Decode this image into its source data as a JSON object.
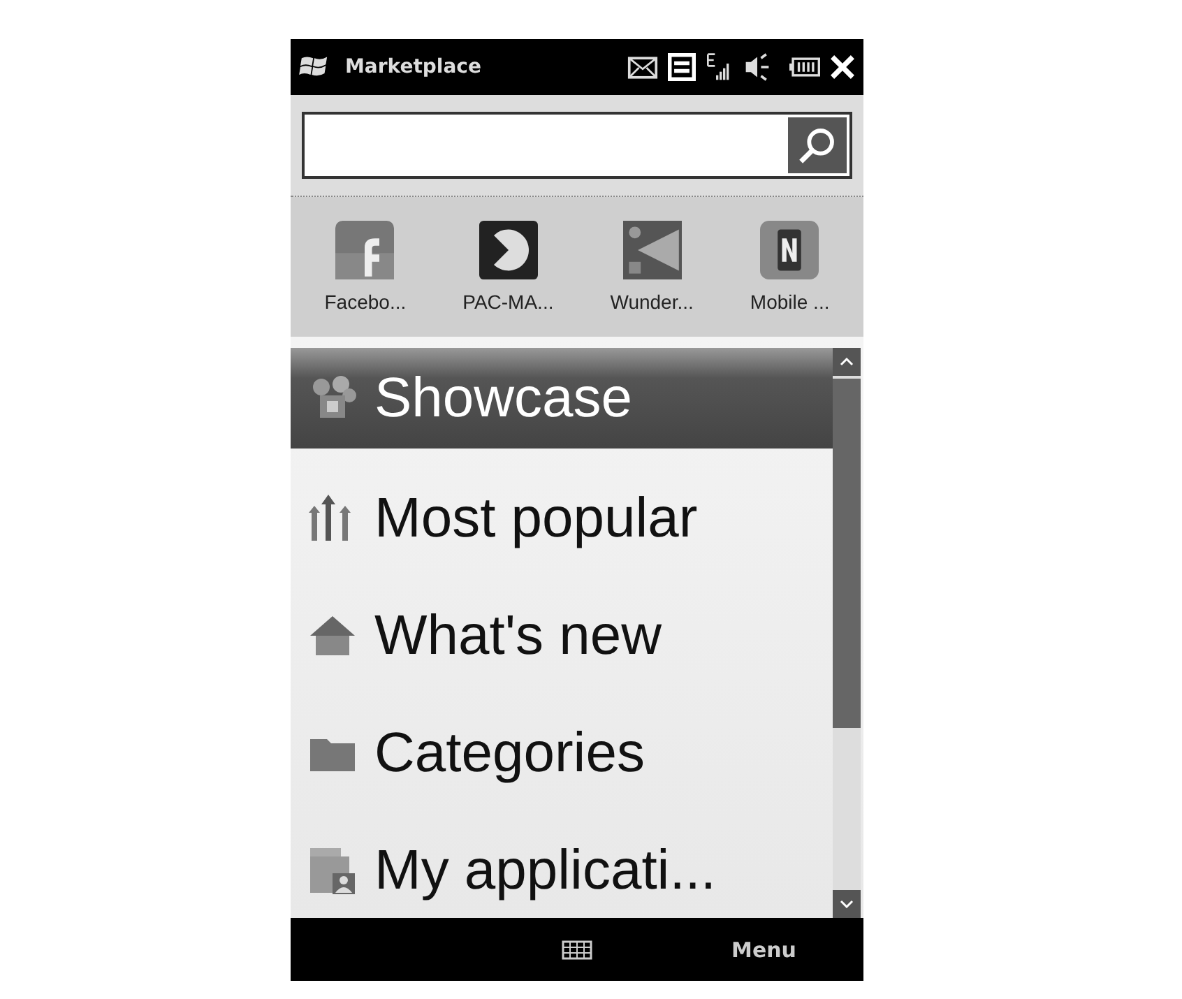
{
  "status_bar": {
    "title": "Marketplace"
  },
  "featured_apps": [
    {
      "name": "Facebo...",
      "kind": "facebook"
    },
    {
      "name": "PAC-MA...",
      "kind": "pacman"
    },
    {
      "name": "Wunder...",
      "kind": "wunder"
    },
    {
      "name": "Mobile ...",
      "kind": "news"
    }
  ],
  "menu_items": [
    {
      "label": "Showcase",
      "kind": "showcase",
      "selected": true
    },
    {
      "label": "Most popular",
      "kind": "popular",
      "selected": false
    },
    {
      "label": "What's new",
      "kind": "new",
      "selected": false
    },
    {
      "label": "Categories",
      "kind": "categories",
      "selected": false
    },
    {
      "label": "My applicati...",
      "kind": "myapps",
      "selected": false
    }
  ],
  "soft_keys": {
    "right": "Menu"
  }
}
